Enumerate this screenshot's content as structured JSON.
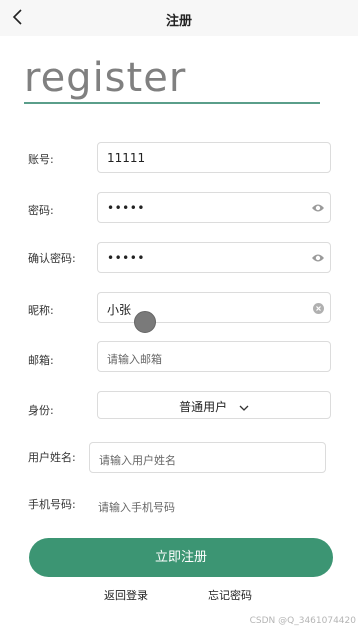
{
  "nav": {
    "title": "注册"
  },
  "hero": {
    "title": "register"
  },
  "form": {
    "account": {
      "label": "账号:",
      "value": "11111"
    },
    "password": {
      "label": "密码:",
      "value": "•••••"
    },
    "confirm": {
      "label": "确认密码:",
      "value": "•••••"
    },
    "nickname": {
      "label": "昵称:",
      "value": "小张"
    },
    "email": {
      "label": "邮箱:",
      "placeholder": "请输入邮箱"
    },
    "identity": {
      "label": "身份:",
      "value": "普通用户"
    },
    "realname": {
      "label": "用户姓名:",
      "placeholder": "请输入用户姓名"
    },
    "phone": {
      "label": "手机号码:",
      "placeholder": "请输入手机号码"
    }
  },
  "actions": {
    "submit": "立即注册",
    "back_login": "返回登录",
    "forgot": "忘记密码"
  },
  "watermark": "CSDN @Q_3461074420",
  "colors": {
    "accent": "#3c9573",
    "underline": "#5a9e8a"
  },
  "icons": [
    "back-icon",
    "eye-icon",
    "clear-icon",
    "chevron-down-icon"
  ]
}
